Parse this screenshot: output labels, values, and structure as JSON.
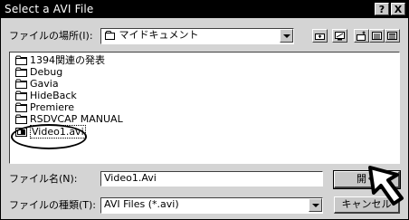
{
  "window": {
    "title": "Select a AVI File"
  },
  "title_buttons": {
    "help_label": "?",
    "close_label": "X"
  },
  "location": {
    "label": "ファイルの場所(I):",
    "value": "マイドキュメント"
  },
  "toolbar": {
    "icons": [
      "up-one-level-icon",
      "desktop-icon",
      "new-folder-icon",
      "list-view-icon",
      "details-view-icon"
    ]
  },
  "files": [
    {
      "name": "1394関連の発表",
      "icon": "folder-icon"
    },
    {
      "name": "Debug",
      "icon": "folder-icon"
    },
    {
      "name": "Gavia",
      "icon": "folder-icon"
    },
    {
      "name": "HideBack",
      "icon": "folder-icon"
    },
    {
      "name": "Premiere",
      "icon": "folder-icon"
    },
    {
      "name": "RSDVCAP MANUAL",
      "icon": "folder-icon"
    },
    {
      "name": "Video1.avi",
      "icon": "video-file-icon",
      "selected": true
    }
  ],
  "filename": {
    "label": "ファイル名(N):",
    "value": "Video1.Avi"
  },
  "filetype": {
    "label": "ファイルの種類(T):",
    "value": "AVI Files (*.avi)"
  },
  "buttons": {
    "open": "開く",
    "cancel": "キャンセル"
  }
}
